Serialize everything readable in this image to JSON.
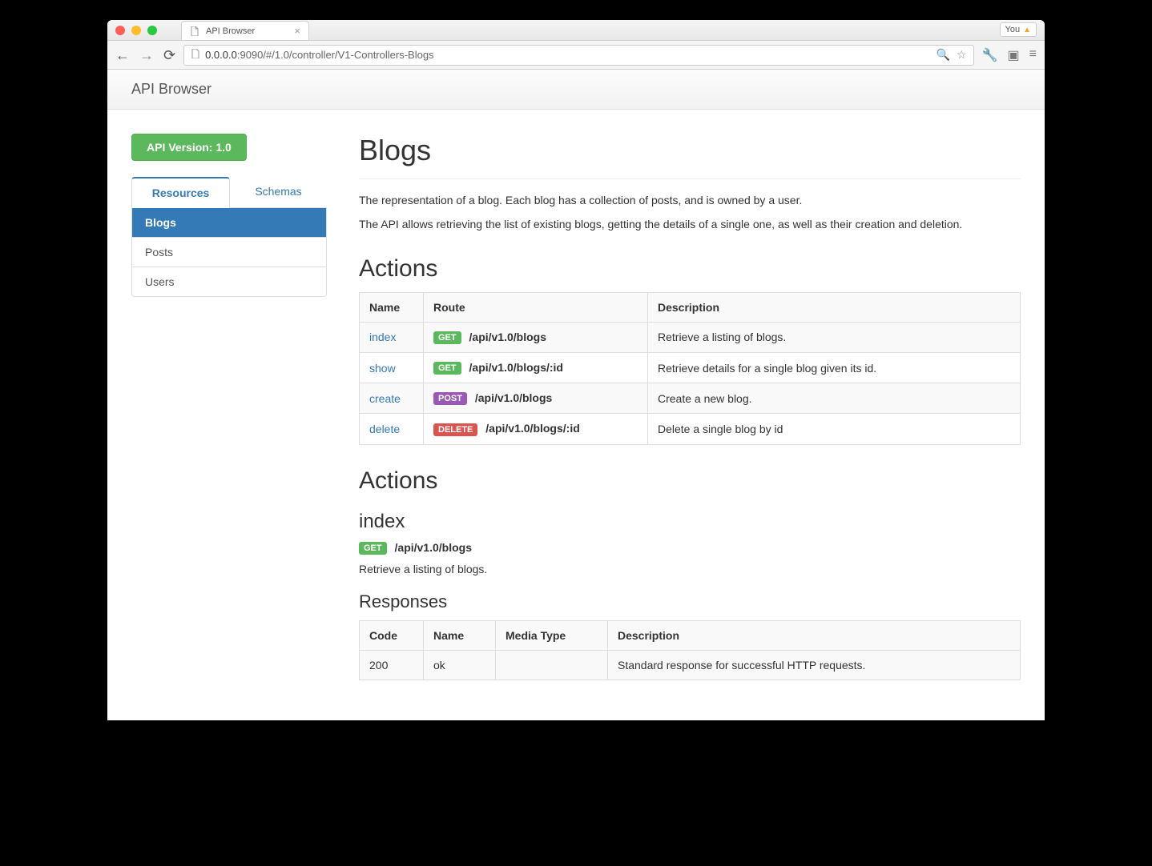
{
  "chrome": {
    "tab_title": "API Browser",
    "you_label": "You",
    "url_host": "0.0.0.0",
    "url_port": ":9090",
    "url_path": "/#/1.0/controller/V1-Controllers-Blogs"
  },
  "app": {
    "brand": "API Browser",
    "version_button": "API Version: 1.0",
    "tabs": {
      "resources": "Resources",
      "schemas": "Schemas"
    },
    "resources": [
      {
        "label": "Blogs",
        "active": true
      },
      {
        "label": "Posts",
        "active": false
      },
      {
        "label": "Users",
        "active": false
      }
    ]
  },
  "main": {
    "title": "Blogs",
    "desc1": "The representation of a blog. Each blog has a collection of posts, and is owned by a user.",
    "desc2": "The API allows retrieving the list of existing blogs, getting the details of a single one, as well as their creation and deletion.",
    "actions_heading": "Actions",
    "actions_table": {
      "headers": {
        "name": "Name",
        "route": "Route",
        "description": "Description"
      },
      "rows": [
        {
          "name": "index",
          "method": "GET",
          "route": "/api/v1.0/blogs",
          "description": "Retrieve a listing of blogs."
        },
        {
          "name": "show",
          "method": "GET",
          "route": "/api/v1.0/blogs/:id",
          "description": "Retrieve details for a single blog given its id."
        },
        {
          "name": "create",
          "method": "POST",
          "route": "/api/v1.0/blogs",
          "description": "Create a new blog."
        },
        {
          "name": "delete",
          "method": "DELETE",
          "route": "/api/v1.0/blogs/:id",
          "description": "Delete a single blog by id"
        }
      ]
    },
    "detail": {
      "heading": "Actions",
      "action_name": "index",
      "method": "GET",
      "route": "/api/v1.0/blogs",
      "summary": "Retrieve a listing of blogs.",
      "responses_heading": "Responses",
      "responses_table": {
        "headers": {
          "code": "Code",
          "name": "Name",
          "media": "Media Type",
          "description": "Description"
        },
        "rows": [
          {
            "code": "200",
            "name": "ok",
            "media": "",
            "description": "Standard response for successful HTTP requests."
          }
        ]
      }
    }
  }
}
